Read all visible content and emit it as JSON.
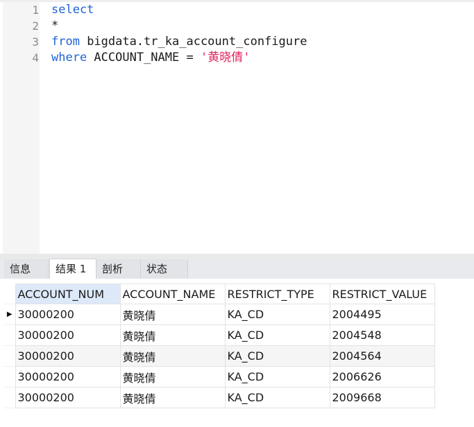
{
  "editor": {
    "lines": [
      {
        "number": "1",
        "tokens": [
          {
            "text": "select",
            "kind": "keyword"
          }
        ]
      },
      {
        "number": "2",
        "tokens": [
          {
            "text": "*",
            "kind": "plain"
          }
        ]
      },
      {
        "number": "3",
        "tokens": [
          {
            "text": "from",
            "kind": "keyword"
          },
          {
            "text": " bigdata.tr_ka_account_configure",
            "kind": "plain"
          }
        ]
      },
      {
        "number": "4",
        "tokens": [
          {
            "text": "where",
            "kind": "keyword"
          },
          {
            "text": " ACCOUNT_NAME = ",
            "kind": "plain"
          },
          {
            "text": "'黄晓倩'",
            "kind": "string"
          }
        ]
      }
    ],
    "colors": {
      "keyword": "#1e63d6",
      "string": "#e0245e",
      "plain": "#1a1a1a",
      "line_number": "#8a8a8a"
    }
  },
  "tabs": [
    {
      "label": "信息",
      "active": false
    },
    {
      "label": "结果 1",
      "active": true
    },
    {
      "label": "剖析",
      "active": false
    },
    {
      "label": "状态",
      "active": false
    }
  ],
  "results": {
    "columns": [
      "ACCOUNT_NUM",
      "ACCOUNT_NAME",
      "RESTRICT_TYPE",
      "RESTRICT_VALUE"
    ],
    "selected_column": "ACCOUNT_NUM",
    "current_row_indicator": "▶",
    "rows": [
      [
        "30000200",
        "黄晓倩",
        "KA_CD",
        "2004495"
      ],
      [
        "30000200",
        "黄晓倩",
        "KA_CD",
        "2004548"
      ],
      [
        "30000200",
        "黄晓倩",
        "KA_CD",
        "2004564"
      ],
      [
        "30000200",
        "黄晓倩",
        "KA_CD",
        "2006626"
      ],
      [
        "30000200",
        "黄晓倩",
        "KA_CD",
        "2009668"
      ]
    ]
  }
}
